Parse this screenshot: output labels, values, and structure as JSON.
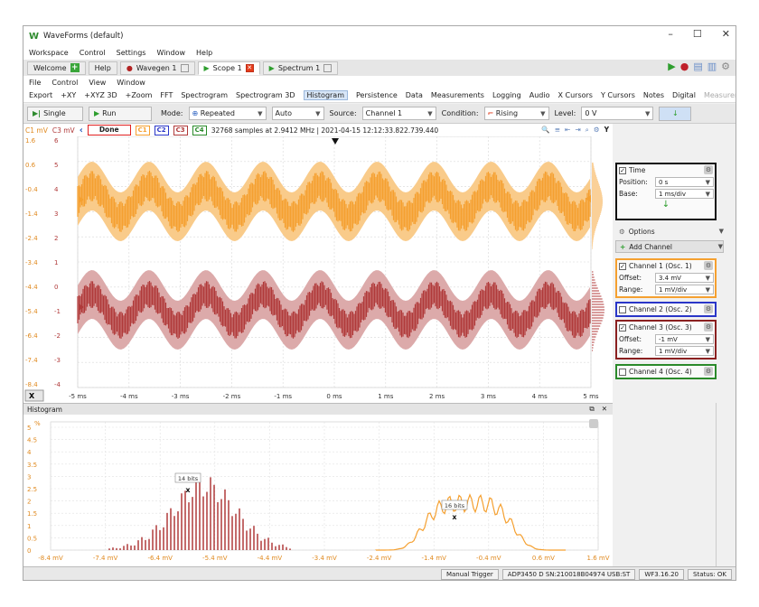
{
  "window": {
    "title": "WaveForms (default)",
    "logo": "W",
    "controls": [
      "–",
      "☐",
      "✕"
    ]
  },
  "menu": [
    "Workspace",
    "Control",
    "Settings",
    "Window",
    "Help"
  ],
  "tabs": [
    {
      "label": "Welcome",
      "icon": "plus-icon"
    },
    {
      "label": "Help"
    },
    {
      "label": "Wavegen 1",
      "icon": "wavegen-icon"
    },
    {
      "label": "Scope 1",
      "icon": "play-icon",
      "active": true
    },
    {
      "label": "Spectrum 1",
      "icon": "play-icon"
    }
  ],
  "submenu": [
    "File",
    "Control",
    "View",
    "Window"
  ],
  "toolbar": [
    "Export",
    "+XY",
    "+XYZ 3D",
    "+Zoom",
    "FFT",
    "Spectrogram",
    "Spectrogram 3D",
    "Histogram",
    "Persistence",
    "Data",
    "Measurements",
    "Logging",
    "Audio",
    "X Cursors",
    "Y Cursors",
    "Notes",
    "Digital",
    "Measurements"
  ],
  "toolbar_selected": "Histogram",
  "controls": {
    "single": "Single",
    "run": "Run",
    "mode_label": "Mode:",
    "mode_value": "Repeated",
    "auto_value": "Auto",
    "source_label": "Source:",
    "source_value": "Channel 1",
    "condition_label": "Condition:",
    "condition_value": "Rising",
    "level_label": "Level:",
    "level_value": "0 V"
  },
  "status_strip": {
    "c1_scale": "C1 mV",
    "c3_scale": "C3 mV",
    "state": "Done",
    "badges": [
      "C1",
      "C2",
      "C3",
      "C4"
    ],
    "info": "32768 samples at 2.9412 MHz | 2021-04-15 12:12:33.822.739.440"
  },
  "colors": {
    "ch1": "#f5a030",
    "ch1_light": "#f9cb8a",
    "ch3": "#b03a3a",
    "ch3_light": "#dcaaaa",
    "ch2": "#2a36c8",
    "ch4": "#2a8a2a"
  },
  "plot": {
    "c1_ticks": [
      "1.6",
      "0.6",
      "-0.4",
      "-1.4",
      "-2.4",
      "-3.4",
      "-4.4",
      "-5.4",
      "-6.4",
      "-7.4",
      "-8.4"
    ],
    "c3_ticks": [
      "6",
      "5",
      "4",
      "3",
      "2",
      "1",
      "0",
      "-1",
      "-2",
      "-3",
      "-4"
    ],
    "x_ticks": [
      "-5 ms",
      "-4 ms",
      "-3 ms",
      "-2 ms",
      "-1 ms",
      "0 ms",
      "1 ms",
      "2 ms",
      "3 ms",
      "4 ms",
      "5 ms"
    ],
    "x_button": "X"
  },
  "time": {
    "title": "Time",
    "position_label": "Position:",
    "position_value": "0 s",
    "base_label": "Base:",
    "base_value": "1 ms/div"
  },
  "options_label": "Options",
  "add_channel_label": "Add Channel",
  "channels": [
    {
      "name": "Channel 1 (Osc. 1)",
      "checked": true,
      "offset_label": "Offset:",
      "offset": "3.4 mV",
      "range_label": "Range:",
      "range": "1 mV/div"
    },
    {
      "name": "Channel 2 (Osc. 2)",
      "checked": false
    },
    {
      "name": "Channel 3 (Osc. 3)",
      "checked": true,
      "offset_label": "Offset:",
      "offset": "-1 mV",
      "range_label": "Range:",
      "range": "1 mV/div"
    },
    {
      "name": "Channel 4 (Osc. 4)",
      "checked": false
    }
  ],
  "histogram": {
    "title": "Histogram",
    "unit": "%",
    "y_ticks": [
      "5",
      "4.5",
      "4",
      "3.5",
      "3",
      "2.5",
      "2",
      "1.5",
      "1",
      "0.5",
      "0"
    ],
    "x_ticks": [
      "-8.4 mV",
      "-7.4 mV",
      "-6.4 mV",
      "-5.4 mV",
      "-4.4 mV",
      "-3.4 mV",
      "-2.4 mV",
      "-1.4 mV",
      "-0.4 mV",
      "0.6 mV",
      "1.6 mV"
    ],
    "label_ch3": "14 bits",
    "label_ch1": "16 bits",
    "marker": "x"
  },
  "statusbar": [
    "Manual Trigger",
    "ADP3450 D SN:210018B04974 USB:ST",
    "WF3.16.20",
    "Status: OK"
  ]
}
